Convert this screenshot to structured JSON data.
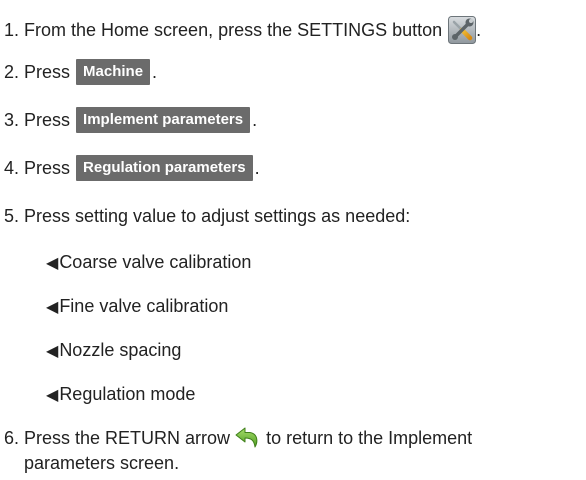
{
  "steps": [
    {
      "pre": "1. From the Home screen, press the SETTINGS button",
      "post": ".",
      "icon": "settings-wrench-screwdriver-icon"
    },
    {
      "pre": "2. Press",
      "button": "Machine",
      "post": "."
    },
    {
      "pre": "3. Press",
      "button": "Implement parameters",
      "post": "."
    },
    {
      "pre": "4. Press",
      "button": "Regulation parameters",
      "post": "."
    },
    {
      "text": "5. Press setting value to adjust settings as needed:"
    },
    {
      "pre": "6. Press the RETURN arrow",
      "icon": "return-arrow-icon",
      "post": "to return to the Implement",
      "continuation": "parameters screen."
    }
  ],
  "sub_items": [
    {
      "marker": "◀",
      "label": "Coarse valve calibration"
    },
    {
      "marker": "◀",
      "label": "Fine valve calibration"
    },
    {
      "marker": "◀",
      "label": "Nozzle spacing"
    },
    {
      "marker": "◀",
      "label": "Regulation mode"
    }
  ],
  "colors": {
    "button_bg": "#6b6b6b",
    "button_text": "#ffffff",
    "return_arrow": "#7ac143",
    "body_text": "#222222"
  }
}
